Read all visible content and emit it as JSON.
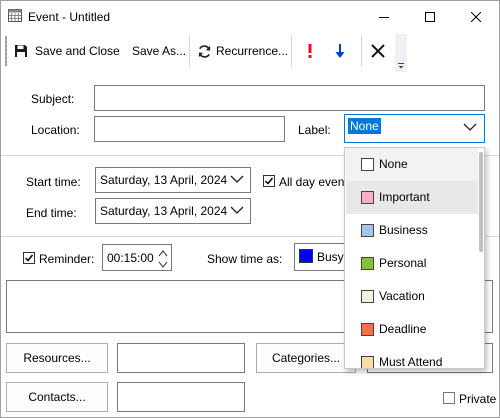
{
  "window": {
    "title": "Event - Untitled"
  },
  "toolbar": {
    "save_close_label": "Save and Close",
    "save_as_label": "Save As...",
    "recurrence_label": "Recurrence...",
    "high_importance_icon": "exclamation-icon",
    "low_importance_icon": "down-arrow-icon",
    "delete_icon": "delete-x-icon"
  },
  "form": {
    "subject_label": "Subject:",
    "subject_value": "",
    "location_label": "Location:",
    "location_value": "",
    "label_label": "Label:",
    "label_value": "None",
    "start_time_label": "Start time:",
    "start_date": "Saturday, 13 April, 2024",
    "end_time_label": "End time:",
    "end_date": "Saturday, 13 April, 2024",
    "all_day_label": "All day event",
    "all_day_checked": true,
    "reminder_label": "Reminder:",
    "reminder_checked": true,
    "reminder_value": "00:15:00",
    "show_time_as_label": "Show time as:",
    "show_time_as_value": "Busy",
    "show_time_as_color": "#0000ff",
    "description": "",
    "resources_button": "Resources...",
    "resources_value": "",
    "categories_button": "Categories...",
    "contacts_button": "Contacts...",
    "contacts_value": "",
    "private_label": "Private",
    "private_checked": false
  },
  "label_dropdown": {
    "items": [
      {
        "label": "None",
        "color": "#ffffff"
      },
      {
        "label": "Important",
        "color": "#f4b3c2"
      },
      {
        "label": "Business",
        "color": "#a9c4e6"
      },
      {
        "label": "Personal",
        "color": "#8ac13a"
      },
      {
        "label": "Vacation",
        "color": "#f4f0dc"
      },
      {
        "label": "Deadline",
        "color": "#f27046"
      },
      {
        "label": "Must Attend",
        "color": "#fcd9a8"
      }
    ],
    "selected_index": 0,
    "hover_index": 1
  },
  "colors": {
    "accent": "#0078d7",
    "high_importance": "#e81123",
    "low_importance": "#0040c0"
  }
}
